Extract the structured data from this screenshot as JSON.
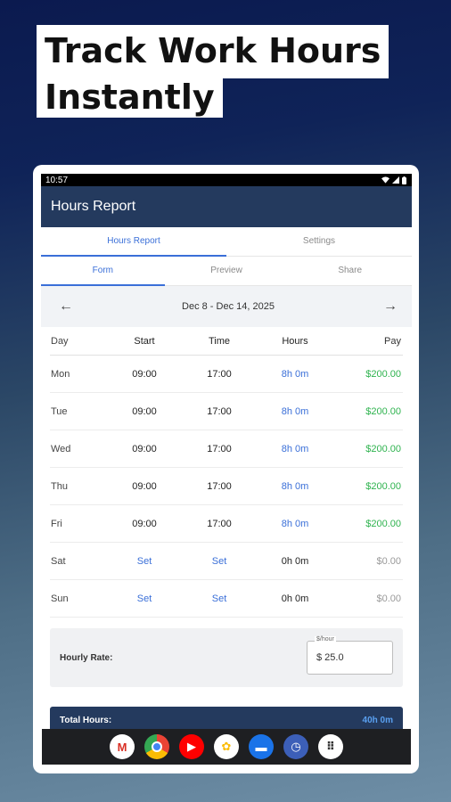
{
  "headline": {
    "line1": "Track Work Hours",
    "line2": "Instantly"
  },
  "status": {
    "time": "10:57"
  },
  "appbar": {
    "title": "Hours Report"
  },
  "tabs": [
    {
      "label": "Hours Report"
    },
    {
      "label": "Settings"
    }
  ],
  "subtabs": [
    {
      "label": "Form"
    },
    {
      "label": "Preview"
    },
    {
      "label": "Share"
    }
  ],
  "week": {
    "range": "Dec 8 - Dec 14, 2025",
    "prev_icon": "arrow-left-icon",
    "next_icon": "arrow-right-icon"
  },
  "table": {
    "headers": [
      "Day",
      "Start",
      "Time",
      "Hours",
      "Pay"
    ],
    "rows": [
      {
        "day": "Mon",
        "start": "09:00",
        "end": "17:00",
        "hours": "8h 0m",
        "pay": "$200.00"
      },
      {
        "day": "Tue",
        "start": "09:00",
        "end": "17:00",
        "hours": "8h 0m",
        "pay": "$200.00"
      },
      {
        "day": "Wed",
        "start": "09:00",
        "end": "17:00",
        "hours": "8h 0m",
        "pay": "$200.00"
      },
      {
        "day": "Thu",
        "start": "09:00",
        "end": "17:00",
        "hours": "8h 0m",
        "pay": "$200.00"
      },
      {
        "day": "Fri",
        "start": "09:00",
        "end": "17:00",
        "hours": "8h 0m",
        "pay": "$200.00"
      },
      {
        "day": "Sat",
        "start": "Set",
        "end": "Set",
        "hours": "0h 0m",
        "pay": "$0.00"
      },
      {
        "day": "Sun",
        "start": "Set",
        "end": "Set",
        "hours": "0h 0m",
        "pay": "$0.00"
      }
    ]
  },
  "rate": {
    "label": "Hourly Rate:",
    "field_legend": "$/hour",
    "value": "$ 25.0"
  },
  "total": {
    "label": "Total Hours:",
    "value": "40h 0m"
  },
  "dock": [
    {
      "name": "gmail-icon",
      "glyph": "M",
      "color": "#ffffff",
      "fg": "#d93025"
    },
    {
      "name": "chrome-icon",
      "glyph": "",
      "color": "#4285f4",
      "fg": "#ffffff"
    },
    {
      "name": "youtube-icon",
      "glyph": "▶",
      "color": "#ff0000",
      "fg": "#ffffff"
    },
    {
      "name": "photos-icon",
      "glyph": "✿",
      "color": "#ffffff",
      "fg": "#fbbc04"
    },
    {
      "name": "messages-icon",
      "glyph": "▬",
      "color": "#1a73e8",
      "fg": "#ffffff"
    },
    {
      "name": "clock-icon",
      "glyph": "◷",
      "color": "#3c5fb8",
      "fg": "#ffffff"
    },
    {
      "name": "app-drawer-icon",
      "glyph": "⠿",
      "color": "#ffffff",
      "fg": "#333333"
    }
  ]
}
